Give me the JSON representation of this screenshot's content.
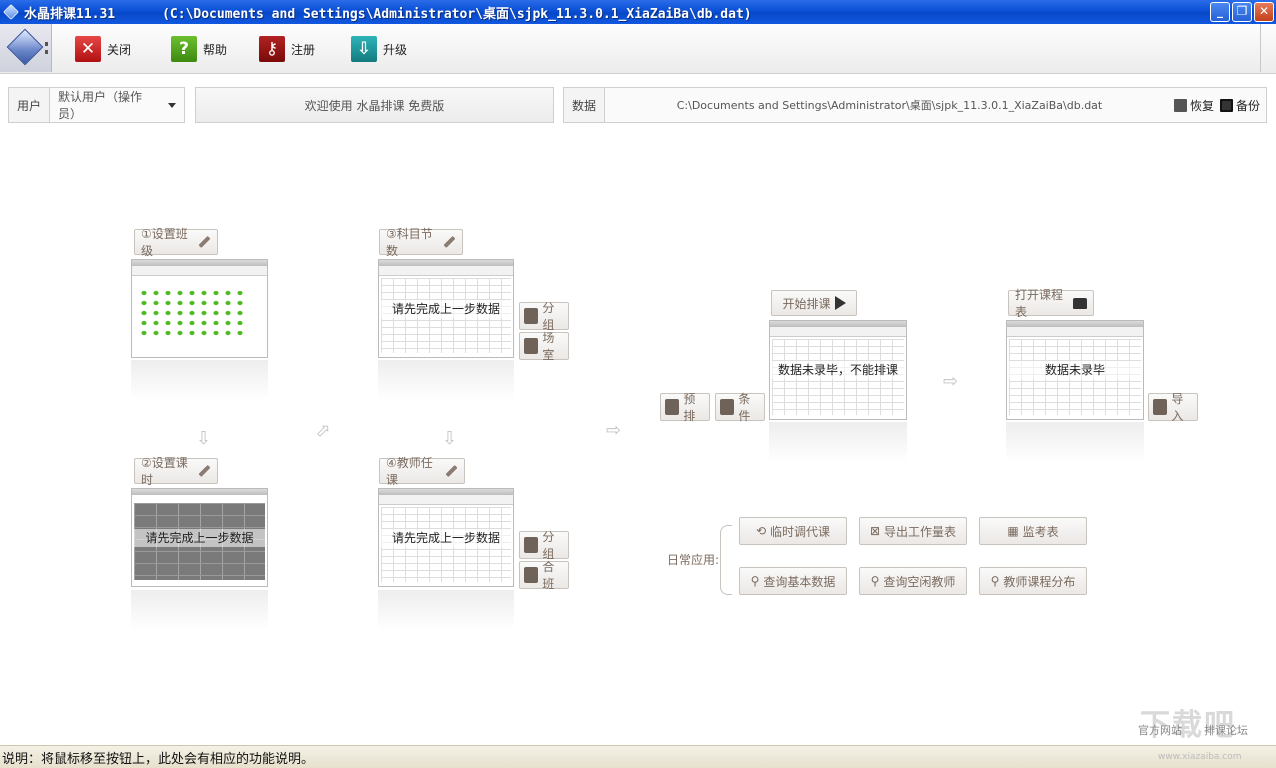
{
  "window": {
    "title": "水晶排课11.31      (C:\\Documents and Settings\\Administrator\\桌面\\sjpk_11.3.0.1_XiaZaiBa\\db.dat)",
    "buttons": [
      "minimize",
      "restore",
      "close"
    ]
  },
  "toolbar": {
    "close_label": "关闭",
    "help_label": "帮助",
    "register_label": "注册",
    "upgrade_label": "升级"
  },
  "info": {
    "user_label": "用户",
    "user_value": "默认用户（操作员）",
    "welcome": "欢迎使用 水晶排课 免费版",
    "data_label": "数据",
    "data_path": "C:\\Documents and Settings\\Administrator\\桌面\\sjpk_11.3.0.1_XiaZaiBa\\db.dat",
    "restore_label": "恢复",
    "backup_label": "备份"
  },
  "steps": {
    "step1": "①设置班级",
    "step2": "②设置课时",
    "step3": "③科目节数",
    "step4": "④教师任课",
    "start": "开始排课",
    "open": "打开课程表",
    "pending_msg": "请先完成上一步数据",
    "schedule_msg": "数据未录毕，不能排课",
    "table_msg": "数据未录毕"
  },
  "side_buttons": {
    "group1": "分组",
    "venue": "场室",
    "group2": "分组",
    "merge": "合班",
    "prearrange": "预排",
    "conditions": "条件",
    "import": "导入"
  },
  "daily": {
    "label": "日常应用:",
    "temp_substitute": "临时调代课",
    "export_workload": "导出工作量表",
    "invigilation": "监考表",
    "query_basic": "查询基本数据",
    "query_free": "查询空闲教师",
    "teacher_dist": "教师课程分布"
  },
  "footer": {
    "status": "说明：将鼠标移至按钮上，此处会有相应的功能说明。",
    "official_site": "官方网站",
    "forum": "排课论坛"
  },
  "watermark": {
    "text": "下载吧",
    "sub": "www.xiazaiba.com"
  }
}
